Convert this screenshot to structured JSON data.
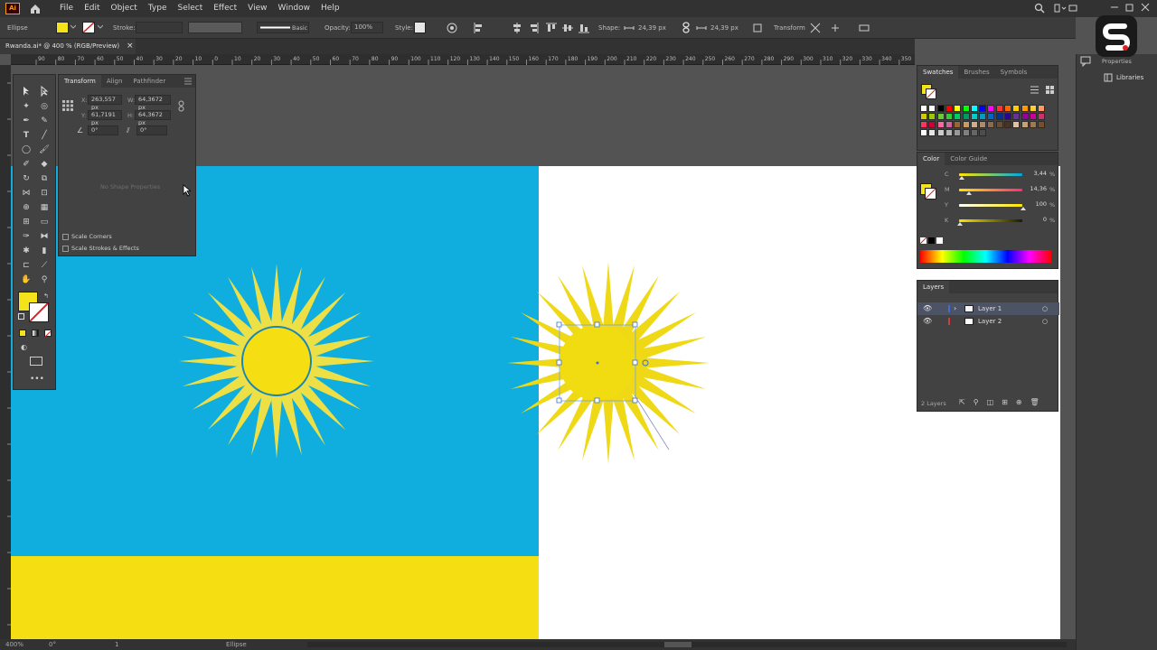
{
  "app": {
    "logo": "Ai",
    "menu": [
      "File",
      "Edit",
      "Object",
      "Type",
      "Select",
      "Effect",
      "View",
      "Window",
      "Help"
    ]
  },
  "control_bar": {
    "object_type": "Ellipse",
    "stroke_label": "Stroke:",
    "brush_label": "Basic",
    "opacity_label": "Opacity:",
    "opacity_value": "100%",
    "style_label": "Style:",
    "shape_label": "Shape:",
    "width_value": "24,39 px",
    "height_value": "24,39 px",
    "transform_label": "Transform"
  },
  "document": {
    "tab_title": "Rwanda.ai* @ 400 % (RGB/Preview)",
    "close": "×"
  },
  "ruler": {
    "ticks": [
      "90",
      "80",
      "70",
      "60",
      "50",
      "40",
      "30",
      "20",
      "10",
      "0",
      "10",
      "20",
      "30",
      "40",
      "50",
      "60",
      "70",
      "80",
      "90",
      "100",
      "110",
      "120",
      "130",
      "140",
      "150",
      "160",
      "170",
      "180",
      "190",
      "200",
      "210",
      "220",
      "230",
      "240",
      "250",
      "260",
      "270",
      "280",
      "290",
      "300",
      "310",
      "320",
      "330",
      "340",
      "350"
    ]
  },
  "transform_panel": {
    "tabs": [
      "Transform",
      "Align",
      "Pathfinder"
    ],
    "x_label": "X:",
    "x_value": "263,557 px",
    "w_label": "W:",
    "w_value": "64,3672 px",
    "y_label": "Y:",
    "y_value": "61,7191 px",
    "h_label": "H:",
    "h_value": "64,3672 px",
    "angle_value": "0°",
    "shear_value": "0°",
    "no_shape": "No Shape Properties",
    "scale_corners": "Scale Corners",
    "scale_strokes": "Scale Strokes & Effects"
  },
  "swatches_panel": {
    "tabs": [
      "Swatches",
      "Brushes",
      "Symbols"
    ]
  },
  "color_panel": {
    "tabs": [
      "Color",
      "Color Guide"
    ],
    "channels": [
      {
        "name": "C",
        "value": "3,44",
        "unit": "%",
        "level": 0.034
      },
      {
        "name": "M",
        "value": "14,36",
        "unit": "%",
        "level": 0.144
      },
      {
        "name": "Y",
        "value": "100",
        "unit": "%",
        "level": 1.0
      },
      {
        "name": "K",
        "value": "0",
        "unit": "%",
        "level": 0.0
      }
    ]
  },
  "layers_panel": {
    "title": "Layers",
    "layers": [
      {
        "name": "Layer 1",
        "color": "#3a6fd8"
      },
      {
        "name": "Layer 2",
        "color": "#d83a3a"
      }
    ],
    "count": "2 Layers"
  },
  "properties_strip": {
    "properties": "Properties",
    "libraries": "Libraries"
  },
  "status_bar": {
    "zoom": "400%",
    "rotation": "0°",
    "artboard": "1",
    "tool": "Ellipse"
  },
  "colors": {
    "flag_blue": "#10AEDF",
    "flag_yellow": "#F5DF12",
    "sun_yellow": "#F0DC10",
    "fill_swatch": "#F4E21B"
  }
}
